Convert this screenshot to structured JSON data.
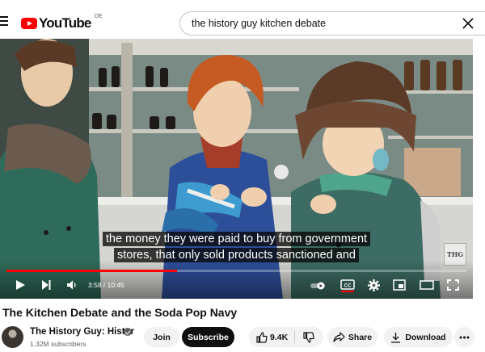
{
  "masthead": {
    "logo_text": "YouTube",
    "country_code": "DE",
    "search_value": "the history guy kitchen debate"
  },
  "player": {
    "caption_line1": "the money they were paid to buy from government",
    "caption_line2": "stores, that only sold products sanctioned and",
    "watermark": "THG",
    "current_time": "3:58",
    "duration": "10:45",
    "time_display": "3:58 / 10:45",
    "progress_fraction": 0.37,
    "icons": [
      "play-icon",
      "next-icon",
      "volume-icon",
      "autoplay-toggle-icon",
      "captions-icon",
      "settings-icon",
      "miniplayer-icon",
      "theater-icon",
      "fullscreen-icon"
    ],
    "accent_color": "#ff0000"
  },
  "video": {
    "title": "The Kitchen Debate and the Soda Pop Navy"
  },
  "channel": {
    "name": "The History Guy: Histor",
    "subscribers": "1.32M subscribers",
    "verified": true
  },
  "actions": {
    "join_label": "Join",
    "subscribe_label": "Subscribe",
    "like_count": "9.4K",
    "share_label": "Share",
    "download_label": "Download"
  }
}
